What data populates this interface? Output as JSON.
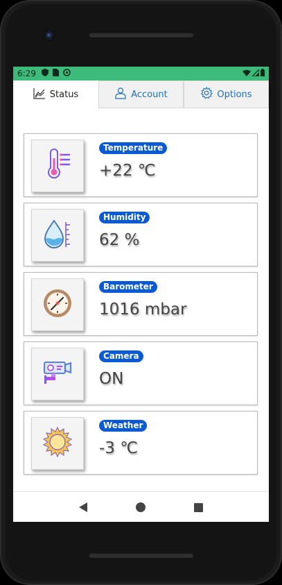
{
  "statusbar": {
    "time": "6:29",
    "left_icons": [
      "shield-icon",
      "sim-icon",
      "sync-icon"
    ],
    "right_icons": [
      "wifi-icon",
      "signal-icon",
      "battery-icon"
    ],
    "color": "#3dbb7a"
  },
  "tabs": [
    {
      "label": "Status",
      "icon": "chart-icon",
      "active": true
    },
    {
      "label": "Account",
      "icon": "user-icon",
      "active": false
    },
    {
      "label": "Options",
      "icon": "gear-icon",
      "active": false
    }
  ],
  "cards": [
    {
      "label": "Temperature",
      "value": "+22 ℃",
      "icon": "thermometer-icon"
    },
    {
      "label": "Humidity",
      "value": "62 %",
      "icon": "water-drop-icon"
    },
    {
      "label": "Barometer",
      "value": "1016 mbar",
      "icon": "barometer-icon"
    },
    {
      "label": "Camera",
      "value": "ON",
      "icon": "security-camera-icon"
    },
    {
      "label": "Weather",
      "value": "-3 ℃",
      "icon": "sun-icon"
    }
  ],
  "colors": {
    "badge": "#0a5bd3",
    "tab_link": "#1f6fb5"
  },
  "navbar": {
    "icons": [
      "back-icon",
      "home-icon",
      "recents-icon"
    ]
  }
}
